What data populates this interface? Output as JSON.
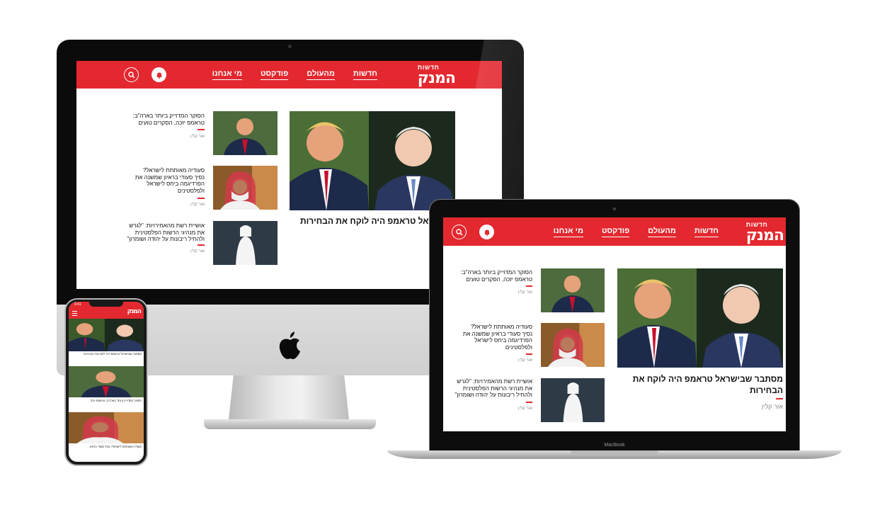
{
  "site": {
    "logo_small": "חדשות",
    "logo_big": "המנק",
    "nav": [
      "חדשות",
      "מהעולם",
      "פודקסט",
      "מי אנחנו"
    ],
    "search_icon": "search-icon",
    "notification_icon": "bell-icon",
    "menu_icon": "hamburger-icon",
    "brand_color": "#e3282f"
  },
  "main_article": {
    "title_imac": "שבישראל טראמפ היה לוקח את הבחירות",
    "title_laptop": "מסתבר שבישראל טראמפ היה לוקח את הבחירות",
    "author": "אור קלין"
  },
  "side_articles": [
    {
      "title": "הסוקר המדוייק ביותר בארה\"ב: טראמפ יזכה, הסקרים טועים",
      "author": "אור קלין"
    },
    {
      "title": "סעודיה מאותתת לישראל? נסיך סעודי בראיון שמשנה את הפרדיגמה ביחס לישראל ולפלסטינים",
      "author": "אור קלין"
    },
    {
      "title": "אושיית רשת מהאמירויות: \"לגרש את מנהיגי הרשות הפלסטינית ולהחיל ריבונות על יהודה ושומרון\"",
      "author": "אור קלין"
    }
  ],
  "devices": {
    "laptop_label": "MacBook",
    "phone_time": "9:41"
  },
  "phone_captions": [
    "מסתבר שבישראל טראמפ היה לוקח את הבחירות",
    "הסוקר המדוייק ביותר בארה\"ב: טראמפ יזכה",
    "סעודיה מאותתת לישראל? נסיך סעודי בראיון"
  ]
}
